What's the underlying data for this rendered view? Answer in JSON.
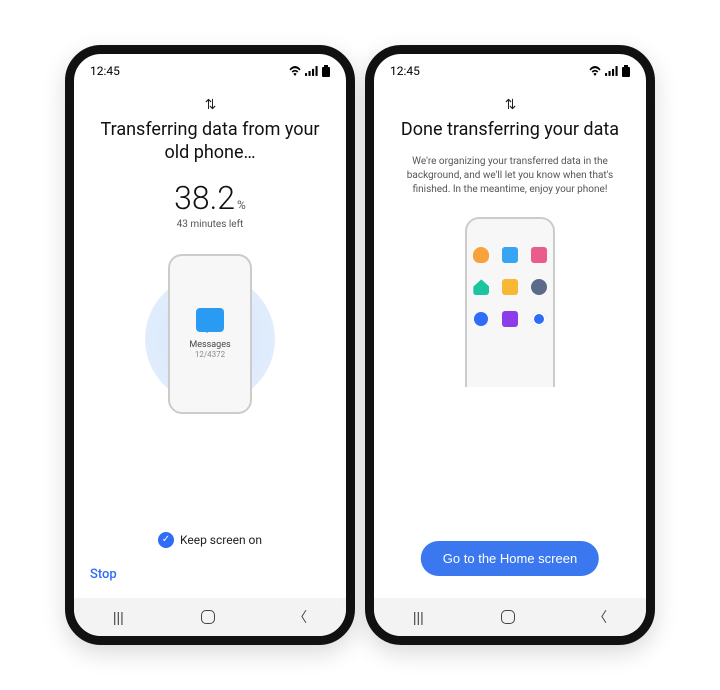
{
  "status": {
    "time": "12:45"
  },
  "left": {
    "title": "Transferring data from your old phone…",
    "percent": "38.2",
    "percent_symbol": "%",
    "time_left": "43 minutes left",
    "item_label": "Messages",
    "item_count": "12/4372",
    "keep_screen_label": "Keep screen on",
    "stop_label": "Stop"
  },
  "right": {
    "title": "Done transferring your data",
    "subtitle": "We're organizing your transferred data in the background, and we'll let you know when that's finished. In the meantime, enjoy your phone!",
    "home_button": "Go to the Home screen"
  },
  "colors": {
    "accent": "#2f6df6",
    "icon_blue": "#299bf3"
  }
}
